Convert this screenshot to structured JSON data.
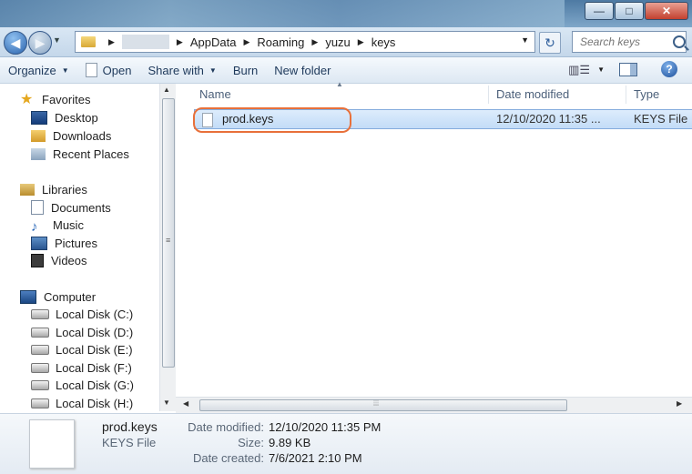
{
  "window": {
    "minimize": "—",
    "maximize": "□",
    "close": "✕"
  },
  "navigation": {
    "back": "◀",
    "forward": "▶",
    "breadcrumb": [
      "AppData",
      "Roaming",
      "yuzu",
      "keys"
    ],
    "search_placeholder": "Search keys"
  },
  "toolbar": {
    "organize": "Organize",
    "open": "Open",
    "share_with": "Share with",
    "burn": "Burn",
    "new_folder": "New folder",
    "help": "?"
  },
  "nav_pane": {
    "favorites": "Favorites",
    "favorites_items": [
      "Desktop",
      "Downloads",
      "Recent Places"
    ],
    "libraries": "Libraries",
    "libraries_items": [
      "Documents",
      "Music",
      "Pictures",
      "Videos"
    ],
    "computer": "Computer",
    "drives": [
      "Local Disk (C:)",
      "Local Disk (D:)",
      "Local Disk (E:)",
      "Local Disk (F:)",
      "Local Disk (G:)",
      "Local Disk (H:)"
    ]
  },
  "columns": {
    "name": "Name",
    "date_modified": "Date modified",
    "type": "Type"
  },
  "files": [
    {
      "name": "prod.keys",
      "date_modified": "12/10/2020 11:35 ...",
      "type": "KEYS File"
    }
  ],
  "details": {
    "file_name": "prod.keys",
    "file_type": "KEYS File",
    "date_modified_label": "Date modified:",
    "date_modified": "12/10/2020 11:35 PM",
    "size_label": "Size:",
    "size": "9.89 KB",
    "date_created_label": "Date created:",
    "date_created": "7/6/2021 2:10 PM"
  },
  "colors": {
    "highlight_outline": "#e8703a",
    "selection": "#cce4fb"
  }
}
